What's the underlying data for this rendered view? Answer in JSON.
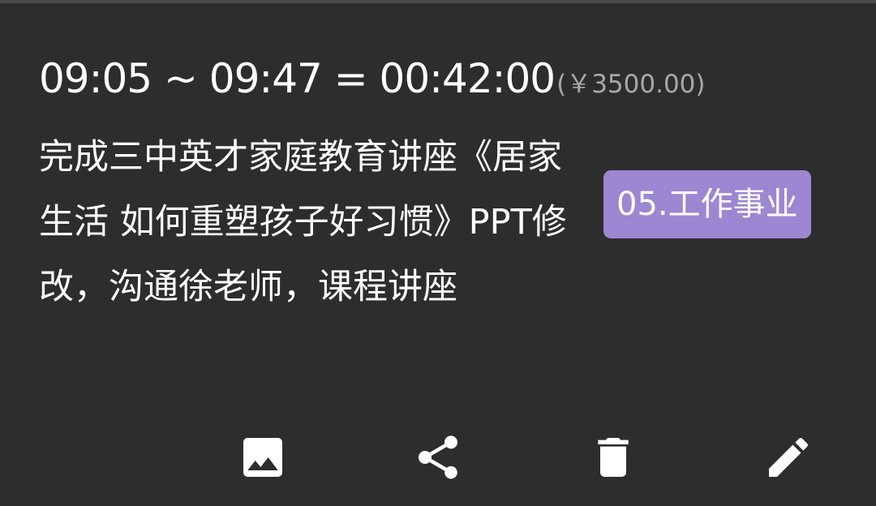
{
  "record": {
    "time_range": "09:05 ~ 09:47 = 00:42:00",
    "amount": "(￥3500.00)",
    "description": "完成三中英才家庭教育讲座《居家生活 如何重塑孩子好习惯》PPT修改，沟通徐老师，课程讲座",
    "category": "05.工作事业"
  },
  "colors": {
    "background": "#2d2d2d",
    "badge": "#9d86d2",
    "amount_text": "#a8a8a8"
  },
  "actions": {
    "image_icon": "image-icon",
    "share_icon": "share-icon",
    "delete_icon": "trash-icon",
    "edit_icon": "pencil-icon"
  }
}
